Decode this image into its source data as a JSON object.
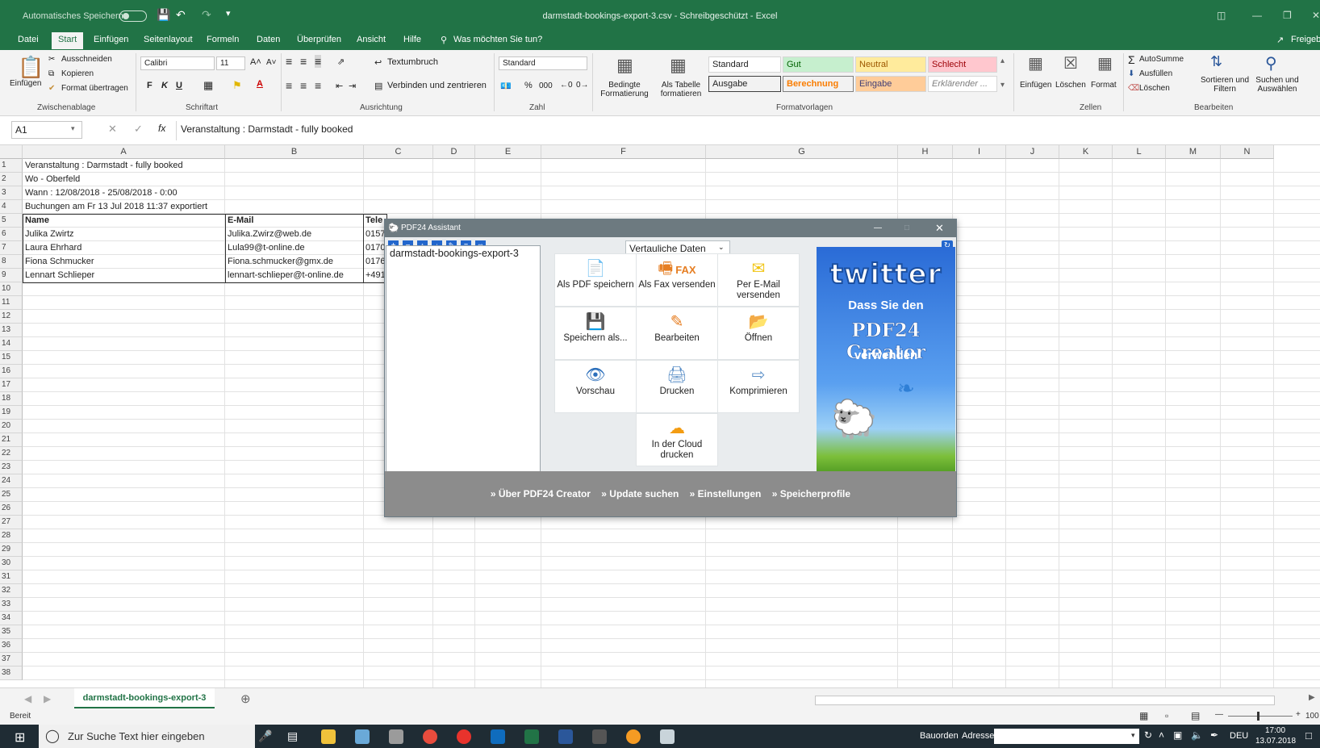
{
  "titlebar": {
    "autosave": "Automatisches Speichern",
    "title": "darmstadt-bookings-export-3.csv  -  Schreibgeschützt  -  Excel",
    "share": "Freigeb"
  },
  "menu": [
    "Datei",
    "Start",
    "Einfügen",
    "Seitenlayout",
    "Formeln",
    "Daten",
    "Überprüfen",
    "Ansicht",
    "Hilfe"
  ],
  "tellme": "Was möchten Sie tun?",
  "ribbon": {
    "clipboard": {
      "paste": "Einfügen",
      "cut": "Ausschneiden",
      "copy": "Kopieren",
      "format": "Format übertragen",
      "group": "Zwischenablage"
    },
    "font": {
      "name": "Calibri",
      "size": "11",
      "bold": "F",
      "italic": "K",
      "underline": "U",
      "group": "Schriftart"
    },
    "align": {
      "wrap": "Textumbruch",
      "merge": "Verbinden und zentrieren",
      "group": "Ausrichtung"
    },
    "number": {
      "format": "Standard",
      "percent": "%",
      "thousands": "000",
      "group": "Zahl"
    },
    "styles": {
      "cond": "Bedingte Formatierung",
      "table": "Als Tabelle formatieren",
      "cells": [
        "Standard",
        "Gut",
        "Neutral",
        "Schlecht",
        "Ausgabe",
        "Berechnung",
        "Eingabe",
        "Erklärender ..."
      ],
      "group": "Formatvorlagen"
    },
    "cells": {
      "insert": "Einfügen",
      "delete": "Löschen",
      "format": "Format",
      "group": "Zellen"
    },
    "edit": {
      "autosum": "AutoSumme",
      "fill": "Ausfüllen",
      "clear": "Löschen",
      "sort": "Sortieren und Filtern",
      "find": "Suchen und Auswählen",
      "group": "Bearbeiten"
    }
  },
  "formula": {
    "namebox": "A1",
    "content": "Veranstaltung : Darmstadt - fully booked"
  },
  "columns": [
    "A",
    "B",
    "C",
    "D",
    "E",
    "F",
    "G",
    "H",
    "I",
    "J",
    "K",
    "L",
    "M",
    "N"
  ],
  "rows": {
    "r1": "Veranstaltung : Darmstadt - fully booked",
    "r2": "Wo - Oberfeld",
    "r3": "Wann : 12/08/2018 - 25/08/2018 - 0:00",
    "r4": "Buchungen am Fr 13 Jul 2018 11:37 exportiert",
    "header": {
      "a": "Name",
      "b": "E-Mail",
      "c": "Tele"
    },
    "data": [
      {
        "a": "Julika Zwirtz",
        "b": "Julika.Zwirz@web.de",
        "c": "0157"
      },
      {
        "a": "Laura Ehrhard",
        "b": "Lula99@t-online.de",
        "c": "0170"
      },
      {
        "a": "Fiona Schmucker",
        "b": "Fiona.schmucker@gmx.de",
        "c": "0176"
      },
      {
        "a": "Lennart Schlieper",
        "b": "lennart-schlieper@t-online.de",
        "c": "+491"
      }
    ]
  },
  "sheet": {
    "tab": "darmstadt-bookings-export-3",
    "status": "Bereit",
    "zoom": "100"
  },
  "dialog": {
    "title": "PDF24 Assistant",
    "profile": "Vertauliche Daten",
    "file": "darmstadt-bookings-export-3",
    "tiles": [
      {
        "label": "Als PDF speichern",
        "icon": "pdf-save-icon"
      },
      {
        "label": "Als Fax versenden",
        "icon": "fax-icon",
        "tag": "FAX"
      },
      {
        "label": "Per E-Mail versenden",
        "icon": "email-icon"
      },
      {
        "label": "Speichern als...",
        "icon": "save-as-icon"
      },
      {
        "label": "Bearbeiten",
        "icon": "pencil-icon"
      },
      {
        "label": "Öffnen",
        "icon": "folder-icon"
      },
      {
        "label": "Vorschau",
        "icon": "eye-icon"
      },
      {
        "label": "Drucken",
        "icon": "printer-icon"
      },
      {
        "label": "Komprimieren",
        "icon": "compress-icon"
      },
      {
        "label": "In der Cloud drucken",
        "icon": "cloud-print-icon"
      }
    ],
    "ad": {
      "brand": "twitter",
      "line1": "Dass Sie den",
      "line2": "PDF24 Creator",
      "line3": "verwenden"
    },
    "footer": [
      "» Über PDF24 Creator",
      "» Update suchen",
      "» Einstellungen",
      "» Speicherprofile"
    ]
  },
  "taskbar": {
    "search": "Zur Suche Text hier eingeben",
    "bauorden": "Bauorden",
    "adresse": "Adresse",
    "lang": "DEU",
    "time": "17:00",
    "date": "13.07.2018"
  }
}
